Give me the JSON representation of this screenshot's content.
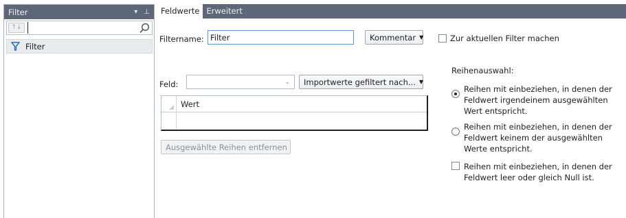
{
  "left_pane": {
    "title": "Filter",
    "sort_icon": "↑↓",
    "search": {
      "value": ""
    },
    "items": [
      {
        "label": "Filter",
        "icon": "funnel-icon"
      }
    ]
  },
  "tabs": [
    {
      "label": "Feldwerte",
      "active": true
    },
    {
      "label": "Erweitert",
      "active": false
    }
  ],
  "form": {
    "filtername_label": "Filtername:",
    "filtername_value": "Filter",
    "kommentar_button": "Kommentar",
    "current_filter_checkbox": "Zur aktuellen Filter machen",
    "feld_label": "Feld:",
    "feld_value": "",
    "import_button": "Importwerte gefiltert nach...",
    "grid": {
      "column": "Wert",
      "rows": [
        ""
      ]
    },
    "remove_button": "Ausgewählte Reihen entfernen"
  },
  "row_selection": {
    "heading": "Reihenauswahl:",
    "option_any": "Reihen mit einbeziehen, in denen der Feldwert irgendeinem ausgewählten Wert entspricht.",
    "option_none": "Reihen mit einbeziehen, in denen der Feldwert keinem der ausgewählten Werte entspricht.",
    "selected": "option_any",
    "empty_checkbox": "Reihen mit einbeziehen, in denen der Feldwert leer oder gleich Null ist."
  },
  "colors": {
    "header_bg": "#5d6778",
    "focus_border": "#5e95d3",
    "funnel": "#2b6cc4"
  }
}
